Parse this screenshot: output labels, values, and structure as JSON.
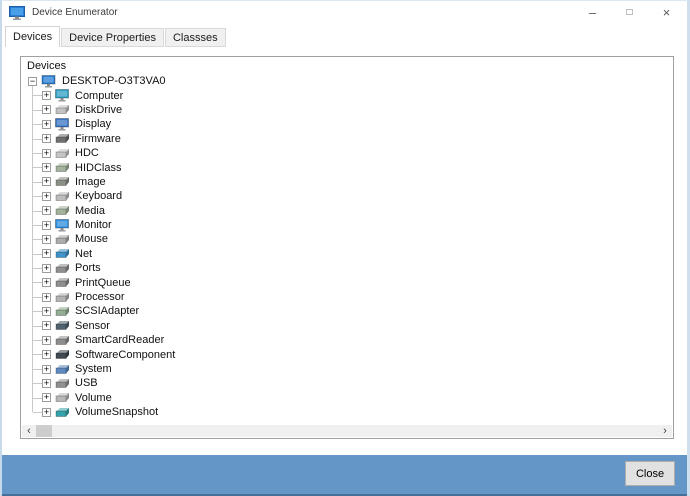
{
  "window": {
    "title": "Device Enumerator",
    "app_icon": "monitor-icon"
  },
  "icons": {
    "minimize": "–",
    "maximize": "□",
    "close": "×",
    "expand": "+",
    "collapse": "−",
    "scroll_left": "‹",
    "scroll_right": "›"
  },
  "tabs": [
    {
      "label": "Devices",
      "active": true
    },
    {
      "label": "Device Properties",
      "active": false
    },
    {
      "label": "Classses",
      "active": false
    }
  ],
  "panel": {
    "label": "Devices"
  },
  "tree": {
    "root": {
      "label": "DESKTOP-O3T3VA0",
      "icon": "desktop-icon",
      "shape": "monitor",
      "color": "#2a7fd4",
      "expanded": true
    },
    "items": [
      {
        "label": "Computer",
        "icon": "computer-icon",
        "shape": "monitor",
        "color": "#2f9fc4",
        "expanded": false
      },
      {
        "label": "DiskDrive",
        "icon": "diskdrive-icon",
        "shape": "box",
        "color": "#c2c2c2",
        "expanded": false
      },
      {
        "label": "Display",
        "icon": "display-icon",
        "shape": "monitor",
        "color": "#3a76c4",
        "expanded": false
      },
      {
        "label": "Firmware",
        "icon": "firmware-icon",
        "shape": "box",
        "color": "#707070",
        "expanded": false
      },
      {
        "label": "HDC",
        "icon": "hdc-icon",
        "shape": "box",
        "color": "#c4c4c4",
        "expanded": false
      },
      {
        "label": "HIDClass",
        "icon": "hidclass-icon",
        "shape": "box",
        "color": "#a3b29b",
        "expanded": false
      },
      {
        "label": "Image",
        "icon": "image-icon",
        "shape": "box",
        "color": "#8b9086",
        "expanded": false
      },
      {
        "label": "Keyboard",
        "icon": "keyboard-icon",
        "shape": "box",
        "color": "#bdbdbd",
        "expanded": false
      },
      {
        "label": "Media",
        "icon": "media-icon",
        "shape": "box",
        "color": "#a3b29b",
        "expanded": false
      },
      {
        "label": "Monitor",
        "icon": "monitor-device-icon",
        "shape": "monitor",
        "color": "#2e8ede",
        "expanded": false
      },
      {
        "label": "Mouse",
        "icon": "mouse-icon",
        "shape": "box",
        "color": "#ababab",
        "expanded": false
      },
      {
        "label": "Net",
        "icon": "net-icon",
        "shape": "box",
        "color": "#3f93c8",
        "expanded": false
      },
      {
        "label": "Ports",
        "icon": "ports-icon",
        "shape": "box",
        "color": "#8f8f8f",
        "expanded": false
      },
      {
        "label": "PrintQueue",
        "icon": "printqueue-icon",
        "shape": "box",
        "color": "#8e8e8e",
        "expanded": false
      },
      {
        "label": "Processor",
        "icon": "processor-icon",
        "shape": "box",
        "color": "#b3b3b3",
        "expanded": false
      },
      {
        "label": "SCSIAdapter",
        "icon": "scsiadapter-icon",
        "shape": "box",
        "color": "#93ad93",
        "expanded": false
      },
      {
        "label": "Sensor",
        "icon": "sensor-icon",
        "shape": "box",
        "color": "#51636f",
        "expanded": false
      },
      {
        "label": "SmartCardReader",
        "icon": "smartcardreader-icon",
        "shape": "box",
        "color": "#8d8d8d",
        "expanded": false
      },
      {
        "label": "SoftwareComponent",
        "icon": "softwarecomponent-icon",
        "shape": "box",
        "color": "#414a52",
        "expanded": false
      },
      {
        "label": "System",
        "icon": "system-icon",
        "shape": "box",
        "color": "#5d88c0",
        "expanded": false
      },
      {
        "label": "USB",
        "icon": "usb-icon",
        "shape": "box",
        "color": "#909090",
        "expanded": false
      },
      {
        "label": "Volume",
        "icon": "volume-icon",
        "shape": "box",
        "color": "#b8b8b8",
        "expanded": false
      },
      {
        "label": "VolumeSnapshot",
        "icon": "volumesnapshot-icon",
        "shape": "box",
        "color": "#34a2aa",
        "expanded": false
      }
    ]
  },
  "footer": {
    "close_label": "Close",
    "background": "#6496c8"
  }
}
